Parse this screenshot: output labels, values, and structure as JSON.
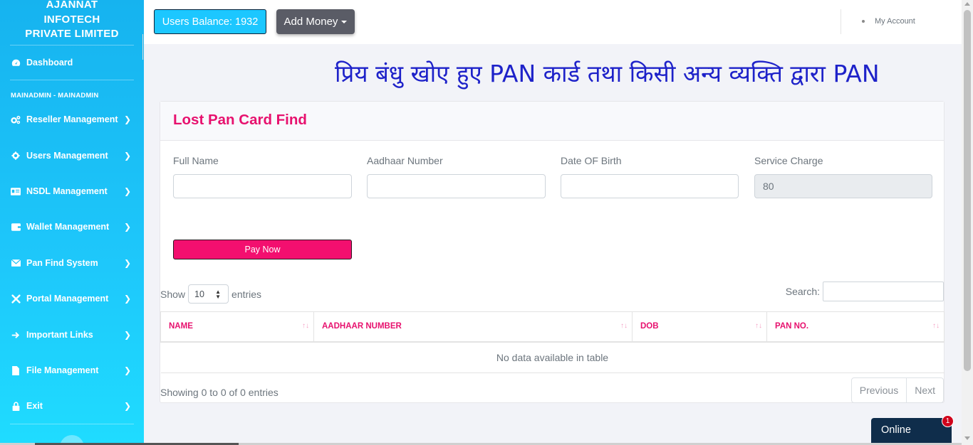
{
  "brand": {
    "line1": "AJANNAT",
    "line2": "INFOTECH",
    "line3": "PRIVATE LIMITED"
  },
  "sidebar": {
    "dashboard": "Dashboard",
    "section": "MAINADMIN - MAINADMIN",
    "items": [
      {
        "label": "Reseller Management",
        "icon": "cogs-icon"
      },
      {
        "label": "Users Management",
        "icon": "gear-icon"
      },
      {
        "label": "NSDL Management",
        "icon": "id-card-icon"
      },
      {
        "label": "Wallet Management",
        "icon": "wallet-icon"
      },
      {
        "label": "Pan Find System",
        "icon": "envelope-icon"
      },
      {
        "label": "Portal Management",
        "icon": "tools-icon"
      },
      {
        "label": "Important Links",
        "icon": "arrow-right-icon"
      },
      {
        "label": "File Management",
        "icon": "file-icon"
      },
      {
        "label": "Exit",
        "icon": "lock-icon"
      }
    ]
  },
  "topbar": {
    "balance": "Users Balance: 1932",
    "add_money": "Add Money",
    "account": "My Account"
  },
  "marquee": "प्रिय बंधु खोए हुए PAN कार्ड तथा किसी अन्य व्यक्ति द्वारा PAN",
  "card": {
    "title": "Lost Pan Card Find",
    "fields": {
      "full_name": {
        "label": "Full Name",
        "value": ""
      },
      "aadhaar": {
        "label": "Aadhaar Number",
        "value": ""
      },
      "dob": {
        "label": "Date OF Birth",
        "value": ""
      },
      "charge": {
        "label": "Service Charge",
        "value": "80"
      }
    },
    "pay_button": "Pay Now"
  },
  "table": {
    "show_label": "Show",
    "entries_select": "10",
    "entries_label": "entries",
    "search_label": "Search:",
    "columns": [
      "NAME",
      "AADHAAR NUMBER",
      "DOB",
      "PAN NO."
    ],
    "empty_text": "No data available in table",
    "info": "Showing 0 to 0 of 0 entries",
    "prev": "Previous",
    "next": "Next"
  },
  "chat": {
    "label": "Online",
    "badge": "1"
  },
  "colors": {
    "accent": "#e7116e",
    "sidebar": "#16b3ef",
    "marquee": "#1e22c9"
  }
}
